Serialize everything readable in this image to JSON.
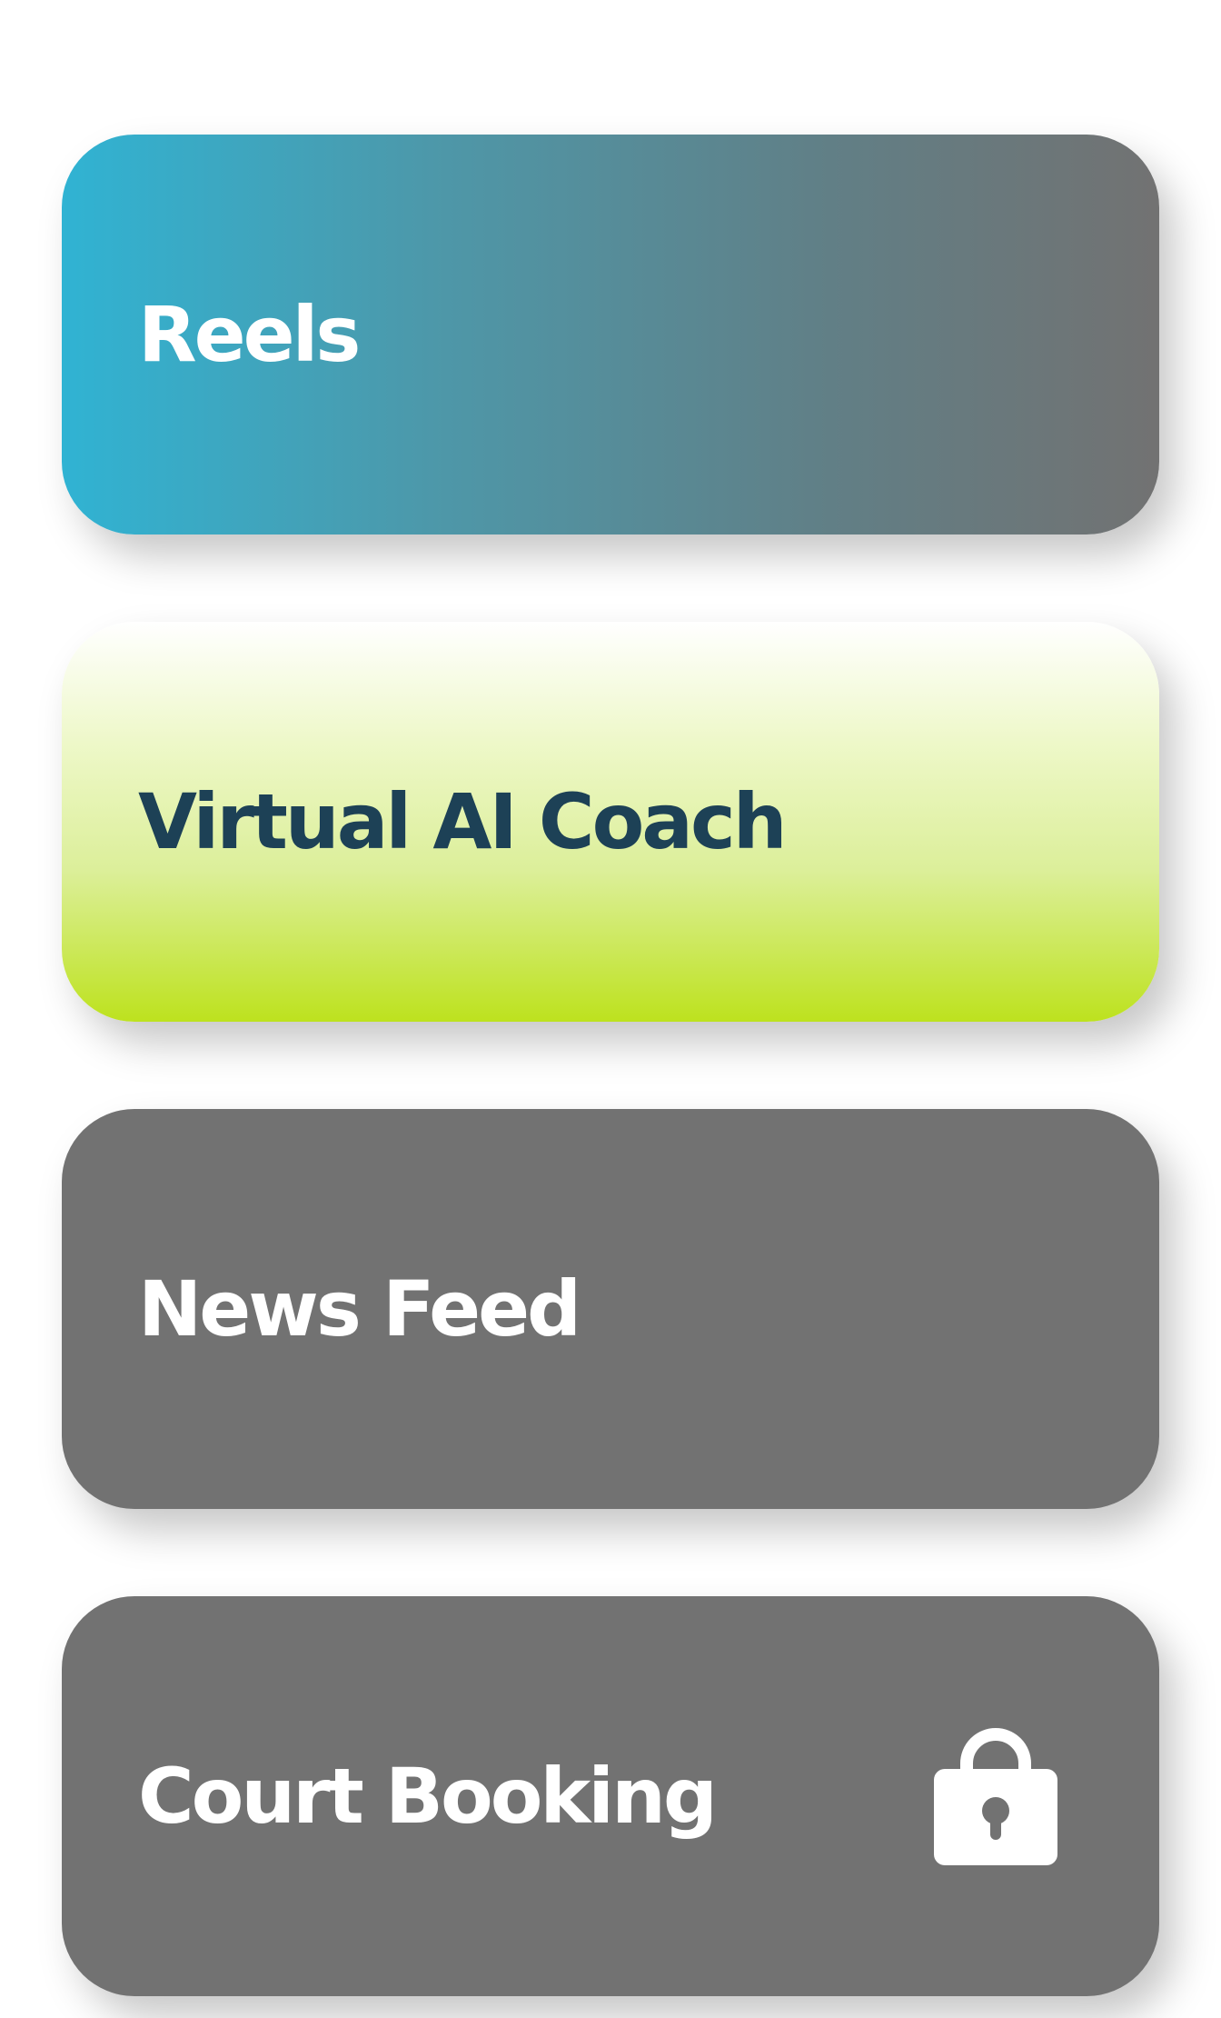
{
  "menu": {
    "items": [
      {
        "label": "Reels"
      },
      {
        "label": "Virtual AI Coach"
      },
      {
        "label": "News Feed"
      },
      {
        "label": "Court Booking",
        "icon": "lock-icon",
        "locked": true
      }
    ]
  },
  "colors": {
    "reels_gradient_start": "#30b3d3",
    "reels_gradient_end": "#727272",
    "coach_gradient_top": "#ffffff",
    "coach_gradient_bottom": "#bde21e",
    "card_gray": "#727272",
    "coach_text": "#1d4156",
    "light_text": "#ffffff"
  }
}
